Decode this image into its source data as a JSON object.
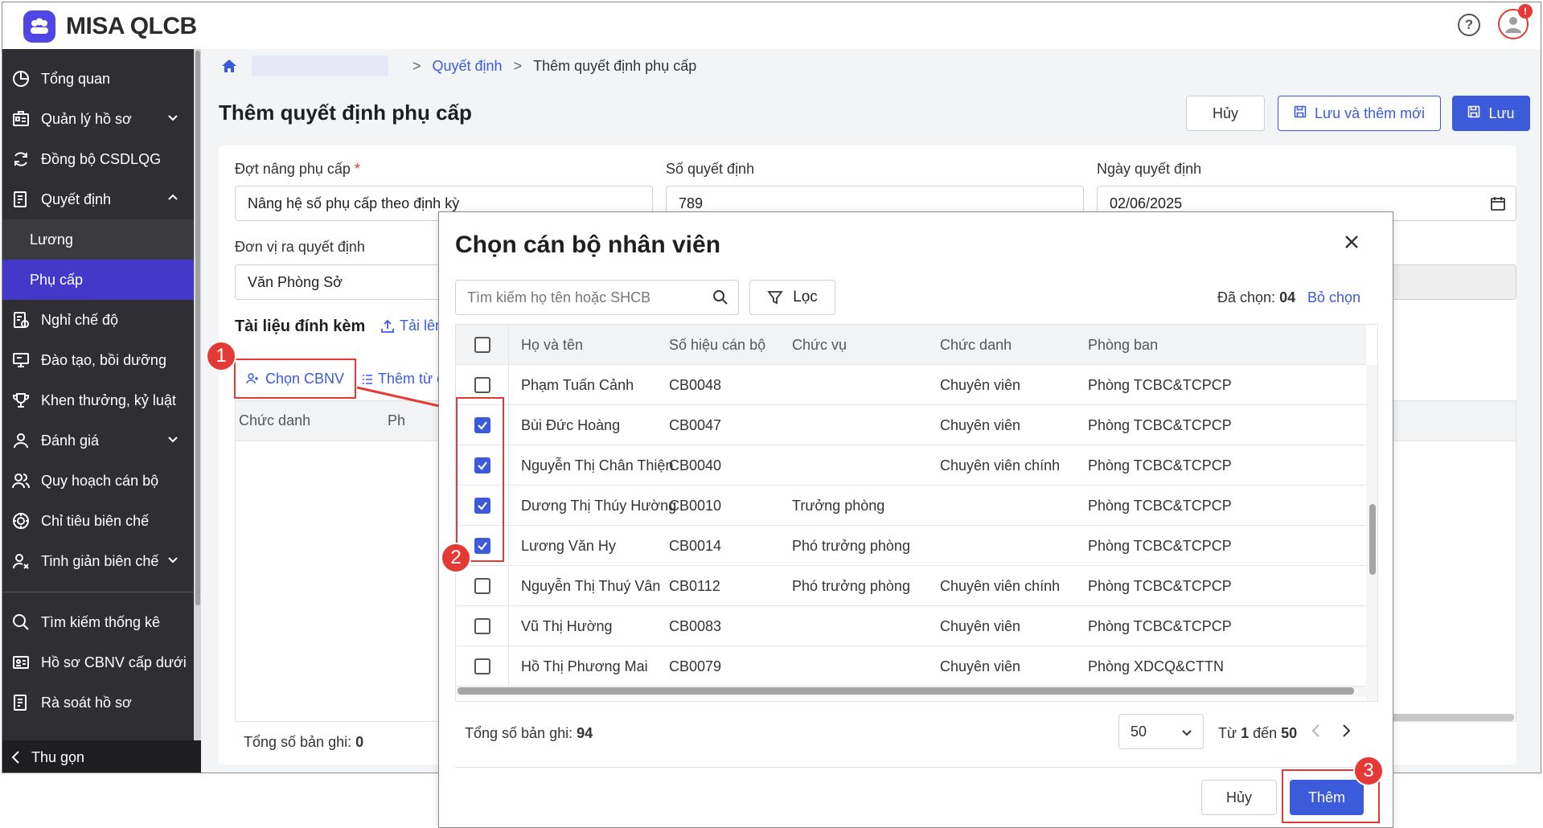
{
  "app": {
    "title": "MISA QLCB",
    "help_symbol": "?",
    "notification_badge": "!"
  },
  "sidebar": {
    "items": [
      {
        "label": "Tổng quan",
        "icon": "dashboard-icon"
      },
      {
        "label": "Quản lý hồ sơ",
        "icon": "profile-icon",
        "expandable": true
      },
      {
        "label": "Đồng bộ CSDLQG",
        "icon": "sync-icon"
      },
      {
        "label": "Quyết định",
        "icon": "document-icon",
        "expanded": true
      },
      {
        "label": "Lương",
        "sub": true
      },
      {
        "label": "Phụ cấp",
        "sub": true,
        "active": true
      },
      {
        "label": "Nghỉ chế độ",
        "icon": "leave-icon"
      },
      {
        "label": "Đào tạo, bồi dưỡng",
        "icon": "training-icon"
      },
      {
        "label": "Khen thưởng, kỷ luật",
        "icon": "trophy-icon"
      },
      {
        "label": "Đánh giá",
        "icon": "evaluate-icon",
        "expandable": true
      },
      {
        "label": "Quy hoạch cán bộ",
        "icon": "people-icon"
      },
      {
        "label": "Chỉ tiêu biên chế",
        "icon": "target-icon"
      },
      {
        "label": "Tinh giản biên chế",
        "icon": "reduce-icon",
        "expandable": true
      },
      {
        "label": "Tìm kiếm thống kê",
        "icon": "search-icon"
      },
      {
        "label": "Hồ sơ CBNV cấp dưới",
        "icon": "id-card-icon"
      },
      {
        "label": "Rà soát hồ sơ",
        "icon": "review-icon"
      }
    ],
    "collapse_label": "Thu gọn"
  },
  "breadcrumb": {
    "link": "Quyết định",
    "current": "Thêm quyết định phụ cấp"
  },
  "page": {
    "title": "Thêm quyết định phụ cấp",
    "cancel_label": "Hủy",
    "save_new_label": "Lưu và thêm mới",
    "save_label": "Lưu"
  },
  "form": {
    "dot_label": "Đợt nâng phụ cấp",
    "dot_required": "*",
    "dot_value": "Nâng hệ số phụ cấp theo định kỳ",
    "so_label": "Số quyết định",
    "so_value": "789",
    "ngay_label": "Ngày quyết định",
    "ngay_value": "02/06/2025",
    "don_vi_label": "Đơn vị ra quyết định",
    "don_vi_value": "Văn Phòng Sở",
    "attach_title": "Tài liệu đính kèm",
    "upload_label": "Tải lên",
    "chon_cbnv_label": "Chọn CBNV",
    "them_tu_label": "Thêm từ d",
    "bg_col_1": "Chức danh",
    "bg_col_2": "Ph",
    "bg_total_label": "Tổng số bản ghi:",
    "bg_total_value": "0"
  },
  "markers": {
    "m1": "1",
    "m2": "2",
    "m3": "3"
  },
  "modal": {
    "title": "Chọn cán bộ nhân viên",
    "search_placeholder": "Tìm kiếm họ tên hoặc SHCB",
    "filter_label": "Lọc",
    "selected_label": "Đã chọn:",
    "selected_count": "04",
    "clear_label": "Bỏ chọn",
    "columns": [
      "Họ và tên",
      "Số hiệu cán bộ",
      "Chức vụ",
      "Chức danh",
      "Phòng ban"
    ],
    "rows": [
      {
        "checked": false,
        "name": "Phạm Tuấn Cảnh",
        "code": "CB0048",
        "position": "",
        "title": "Chuyên viên",
        "dept": "Phòng TCBC&TCPCP"
      },
      {
        "checked": true,
        "name": "Bùi Đức Hoàng",
        "code": "CB0047",
        "position": "",
        "title": "Chuyên viên",
        "dept": "Phòng TCBC&TCPCP"
      },
      {
        "checked": true,
        "name": "Nguyễn Thị Chân Thiện",
        "code": "CB0040",
        "position": "",
        "title": "Chuyên viên chính",
        "dept": "Phòng TCBC&TCPCP"
      },
      {
        "checked": true,
        "name": "Dương Thị Thúy Hường",
        "code": "CB0010",
        "position": "Trưởng phòng",
        "title": "",
        "dept": "Phòng TCBC&TCPCP"
      },
      {
        "checked": true,
        "name": "Lương Văn Hy",
        "code": "CB0014",
        "position": "Phó trưởng phòng",
        "title": "",
        "dept": "Phòng TCBC&TCPCP"
      },
      {
        "checked": false,
        "name": "Nguyễn Thị Thuý Vân",
        "code": "CB0112",
        "position": "Phó trưởng phòng",
        "title": "Chuyên viên chính",
        "dept": "Phòng TCBC&TCPCP"
      },
      {
        "checked": false,
        "name": "Vũ Thị Hường",
        "code": "CB0083",
        "position": "",
        "title": "Chuyên viên",
        "dept": "Phòng TCBC&TCPCP"
      },
      {
        "checked": false,
        "name": "Hồ Thị Phương Mai",
        "code": "CB0079",
        "position": "",
        "title": "Chuyên viên",
        "dept": "Phòng XDCQ&CTTN"
      }
    ],
    "total_label": "Tổng số bản ghi:",
    "total_value": "94",
    "page_size": "50",
    "range_from": "Từ",
    "range_start": "1",
    "range_to": "đến",
    "range_end": "50",
    "cancel_label": "Hủy",
    "add_label": "Thêm"
  },
  "colors": {
    "accent": "#3b5bdb",
    "sidebar_bg": "#2f2f33",
    "active_nav": "#4338ca",
    "marker": "#e53935"
  }
}
